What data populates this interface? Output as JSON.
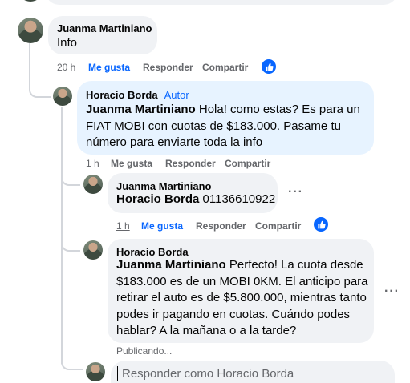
{
  "comments": [
    {
      "id": "c1",
      "author": "Juanma Martiniano",
      "text": "Info",
      "time": "20 h",
      "like_label": "Me gusta",
      "reply_label": "Responder",
      "share_label": "Compartir"
    },
    {
      "id": "c2",
      "author": "Horacio Borda",
      "badge": "Autor",
      "mention": "Juanma Martiniano",
      "text": " Hola! como estas? Es para un FIAT MOBI con cuotas de $183.000. Pasame tu número para enviarte toda la info",
      "time": "1 h",
      "like_label": "Me gusta",
      "reply_label": "Responder",
      "share_label": "Compartir"
    },
    {
      "id": "c3",
      "author": "Juanma Martiniano",
      "mention": "Horacio Borda",
      "text": " 01136610922",
      "time": "1 h",
      "like_label": "Me gusta",
      "reply_label": "Responder",
      "share_label": "Compartir"
    },
    {
      "id": "c4",
      "author": "Horacio Borda",
      "mention": "Juanma Martiniano",
      "text": " Perfecto! La cuota desde $183.000 es de un MOBI 0KM. El anticipo para retirar el auto es de $5.800.000, mientras tanto podes ir pagando en cuotas. Cuándo podes hablar? A la mañana o a la tarde?",
      "status": "Publicando..."
    }
  ],
  "reply_box": {
    "placeholder": "Responder como Horacio Borda"
  },
  "colors": {
    "accent": "#0866ff",
    "bubble_gray": "#f0f2f5",
    "bubble_blue": "#e7f3ff",
    "meta": "#65676b"
  },
  "icons": {
    "like": "like-thumb-icon",
    "more": "more-dots-icon"
  }
}
